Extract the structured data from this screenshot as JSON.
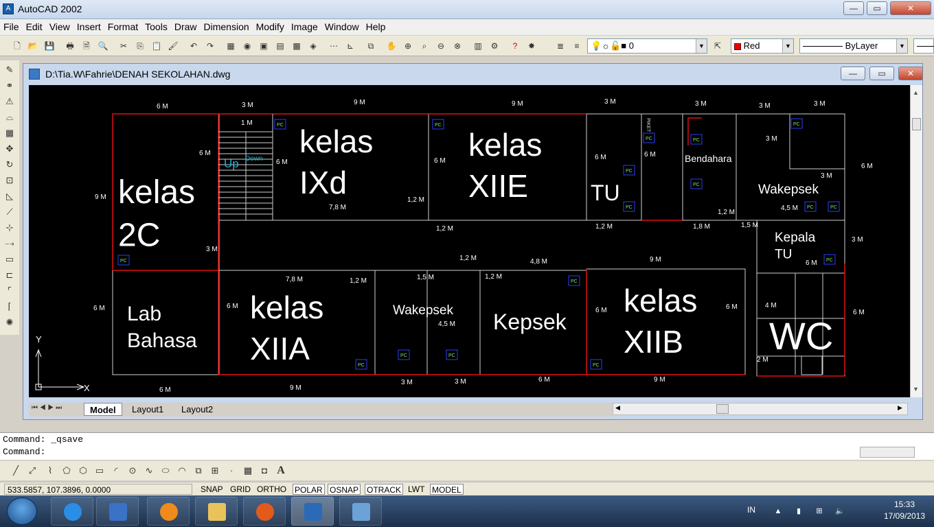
{
  "window": {
    "title": "AutoCAD 2002",
    "min": "—",
    "max": "▭",
    "close": "✕"
  },
  "menu": [
    "File",
    "Edit",
    "View",
    "Insert",
    "Format",
    "Tools",
    "Draw",
    "Dimension",
    "Modify",
    "Image",
    "Window",
    "Help"
  ],
  "toolbar": {
    "layer_value": "0",
    "color_value": "Red",
    "linetype_value": "ByLayer",
    "icons": [
      "new-icon",
      "open-icon",
      "save-icon",
      "print-icon",
      "preview-icon",
      "find-icon",
      "cut-icon",
      "copy-icon",
      "paste-icon",
      "match-icon",
      "undo-icon",
      "redo-icon",
      "pan-icon",
      "zoom-icon",
      "help-icon"
    ]
  },
  "document": {
    "title": "D:\\Tia.W\\Fahrie\\DENAH SEKOLAHAN.dwg"
  },
  "layout_tabs": [
    "Model",
    "Layout1",
    "Layout2"
  ],
  "ucs": {
    "x": "X",
    "y": "Y"
  },
  "plan": {
    "rooms": [
      "kelas\n2C",
      "kelas\nIXd",
      "kelas\nXIIE",
      "TU",
      "Bendahara",
      "Wakepsek",
      "Kepala\nTU",
      "Lab\nBahasa",
      "kelas\nXIIA",
      "Wakepsek",
      "Kepsek",
      "kelas\nXIIB",
      "WC"
    ],
    "stair_up": "Up",
    "stair_down": "Down",
    "piket": "PIKET",
    "pc": "PC",
    "dims": [
      "6 M",
      "3 M",
      "9 M",
      "9 M",
      "3 M",
      "3 M",
      "3 M",
      "3 M",
      "1 M",
      "6 M",
      "6 M",
      "6 M",
      "6 M",
      "9 M",
      "6 M",
      "7,8 M",
      "1,2 M",
      "1,2 M",
      "1,2 M",
      "1,8 M",
      "1,5 M",
      "3 M",
      "1,2 M",
      "4,5 M",
      "3 M",
      "3 M",
      "6 M",
      "1,2 M",
      "4,8 M",
      "9 M",
      "7,8 M",
      "1,2 M",
      "1,5 M",
      "1,2 M",
      "4,5 M",
      "6 M",
      "6 M",
      "6 M",
      "6 M",
      "4 M",
      "6 M",
      "2 M",
      "6 M",
      "9 M",
      "3 M",
      "3 M",
      "6 M",
      "9 M",
      "3 M",
      "6 M"
    ]
  },
  "command": {
    "line1": "Command: _qsave",
    "line2": "Command:"
  },
  "status": {
    "coords": "533.5857, 107.3896, 0.0000",
    "buttons": [
      "SNAP",
      "GRID",
      "ORTHO",
      "POLAR",
      "OSNAP",
      "OTRACK",
      "LWT",
      "MODEL"
    ]
  },
  "taskbar": {
    "lang": "IN",
    "time": "15:33",
    "date": "17/09/2013"
  }
}
